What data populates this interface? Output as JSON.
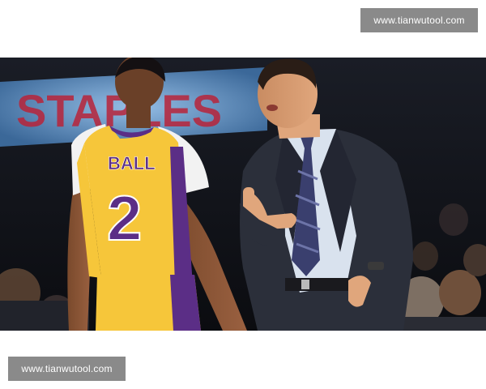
{
  "watermarks": {
    "top": "www.tianwutool.com",
    "bottom": "www.tianwutool.com"
  },
  "photo": {
    "scoreboard_text": "STAPLES",
    "jersey_name": "BALL",
    "jersey_number": "2",
    "colors": {
      "lakers_gold": "#f6c63a",
      "lakers_purple": "#5b2e86",
      "suit": "#2b2f3a",
      "shirt": "#d9e2ee",
      "tie": "#3a3f6e",
      "board_glow": "#7fb4e6",
      "board_text": "#b8243a"
    }
  }
}
